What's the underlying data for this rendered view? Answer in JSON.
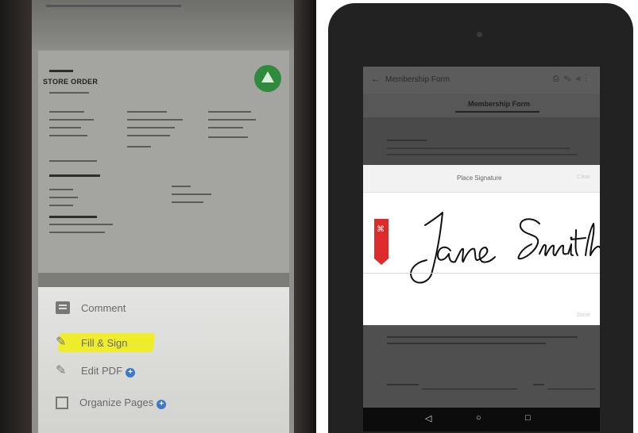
{
  "left": {
    "document_title": "STORE ORDER",
    "menu": [
      {
        "label": "Comment",
        "icon": "comment-icon",
        "badge": ""
      },
      {
        "label": "Fill & Sign",
        "icon": "fill-sign-icon",
        "badge": "",
        "highlighted": true
      },
      {
        "label": "Edit PDF",
        "icon": "pen-icon",
        "badge": "+"
      },
      {
        "label": "Organize Pages",
        "icon": "organize-icon",
        "badge": "+"
      }
    ],
    "highlight_color": "#f2f000",
    "logo_color": "#2f8a3d"
  },
  "right": {
    "app_bar_title": "Membership Form",
    "back_glyph": "←",
    "actions_glyphs": "⎙✎⋖⋮",
    "tab_title": "Membership Form",
    "signature_panel_title": "Place Signature",
    "clear_label": "Clear",
    "done_label": "Done",
    "signature_text": "Jane Smith",
    "ribbon_color": "#dd2a2a",
    "nav": {
      "back": "◁",
      "home": "○",
      "recents": "□"
    }
  }
}
